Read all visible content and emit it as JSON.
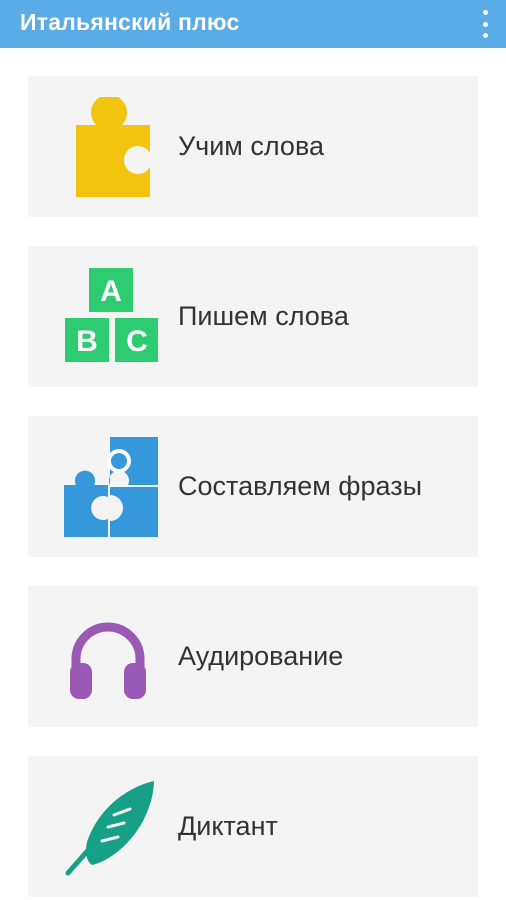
{
  "app": {
    "title": "Итальянский плюс"
  },
  "menu": {
    "items": [
      {
        "label": "Учим слова",
        "icon": "puzzle-piece-icon",
        "color": "#f2c40f"
      },
      {
        "label": "Пишем слова",
        "icon": "abc-blocks-icon",
        "color": "#2ecc71",
        "letters": [
          "A",
          "B",
          "C"
        ]
      },
      {
        "label": "Составляем фразы",
        "icon": "puzzle-pieces-icon",
        "color": "#3498db"
      },
      {
        "label": "Аудирование",
        "icon": "headphones-icon",
        "color": "#9b59b6"
      },
      {
        "label": "Диктант",
        "icon": "feather-icon",
        "color": "#16a085"
      }
    ]
  }
}
